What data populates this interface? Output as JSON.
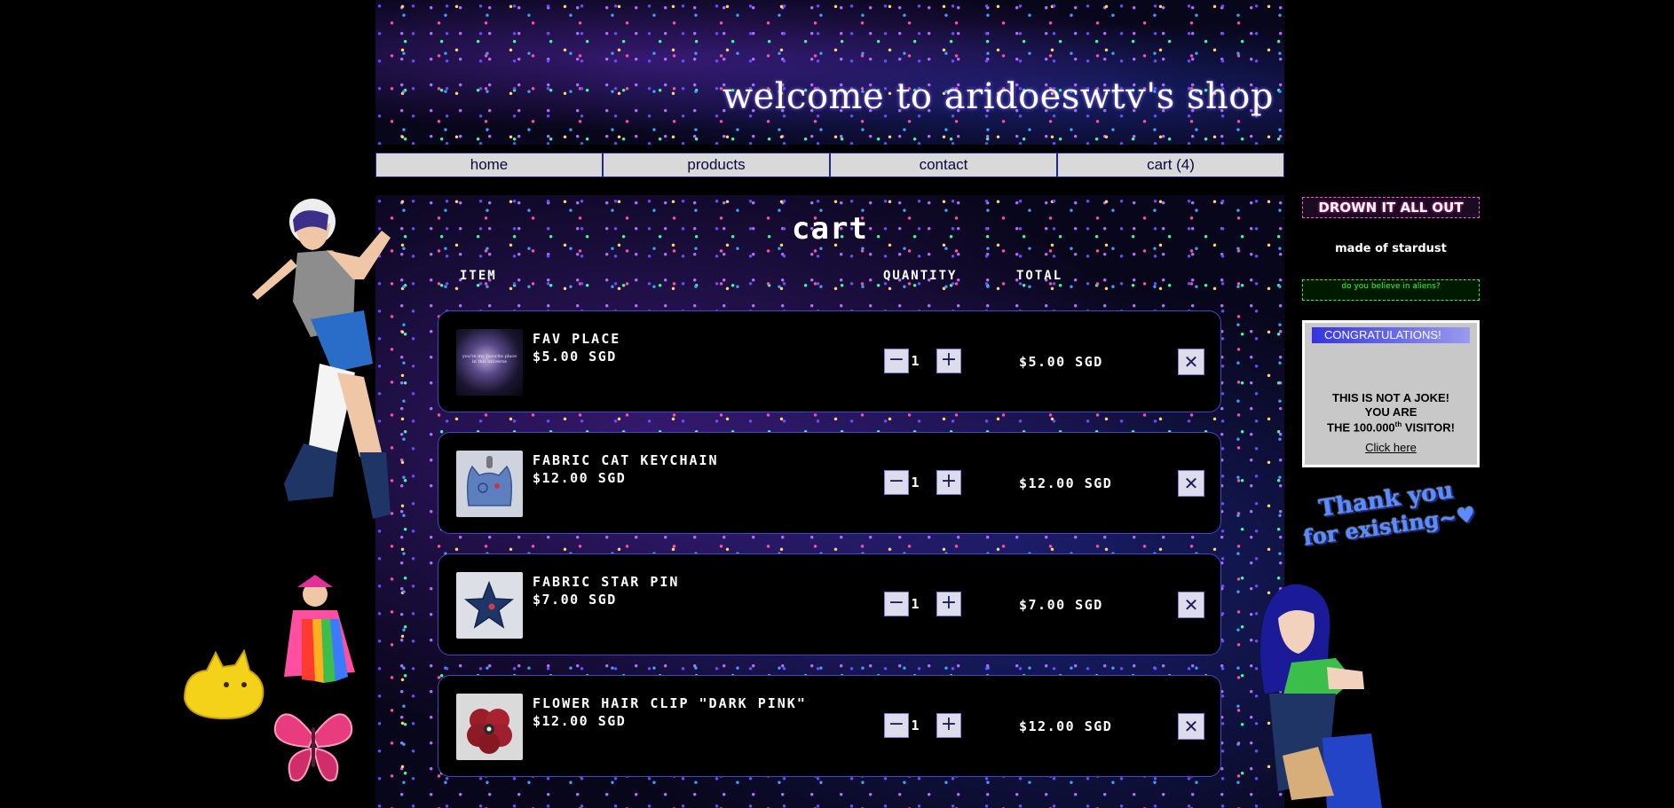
{
  "site_title": "welcome to aridoeswtv's shop",
  "nav": [
    {
      "label": "home"
    },
    {
      "label": "products"
    },
    {
      "label": "contact"
    },
    {
      "label": "cart (4)"
    }
  ],
  "cart": {
    "title": "cart",
    "col_item": "ITEM",
    "col_quantity": "QUANTITY",
    "col_total": "TOTAL",
    "minus_label": "−",
    "plus_label": "+",
    "remove_label": "✕",
    "items": [
      {
        "name": "FAV PLACE",
        "price": "$5.00 SGD",
        "qty": "1",
        "total": "$5.00 SGD",
        "thumb_caption": "you're my favorite place in this universe"
      },
      {
        "name": "FABRIC CAT KEYCHAIN",
        "price": "$12.00 SGD",
        "qty": "1",
        "total": "$12.00 SGD"
      },
      {
        "name": "FABRIC STAR PIN",
        "price": "$7.00 SGD",
        "qty": "1",
        "total": "$7.00 SGD"
      },
      {
        "name": "FLOWER HAIR CLIP \"DARK PINK\"",
        "price": "$12.00 SGD",
        "qty": "1",
        "total": "$12.00 SGD"
      }
    ]
  },
  "sidebar": {
    "banner1": "DROWN IT ALL OUT",
    "banner2": "made of stardust",
    "banner3": "do you believe in aliens?",
    "popup": {
      "title": "CONGRATULATIONS!",
      "line1": "THIS IS NOT A JOKE!",
      "line2": "YOU ARE",
      "line3_a": "THE 100.000",
      "line3_sup": "th",
      "line3_b": " VISITOR!",
      "link": "Click here"
    },
    "thanks_line1": "Thank you",
    "thanks_line2": "for existing~♥"
  },
  "colors": {
    "nav_bg": "#d9d9d9",
    "row_border": "#4545c8",
    "button_bg": "#dcdcec"
  }
}
